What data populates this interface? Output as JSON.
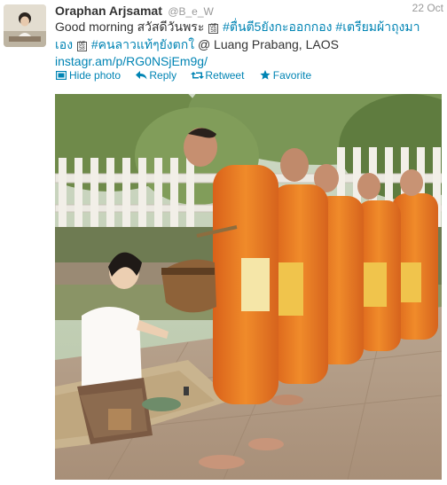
{
  "tweet": {
    "fullname": "Oraphan Arjsamat",
    "username": "@B_e_W",
    "timestamp": "22 Oct",
    "text": {
      "part1": "Good morning สวัสดีวันพระ ",
      "hashtag1": "#ตื่นตี5ยังกะออกกอง",
      "space1": " ",
      "hashtag2": "#เตรียมผ้าถุงมาเอง",
      "space2": " ",
      "hashtag3": "#คนลาวแท้ๆยังตกใ",
      "part2": " @ Luang Prabang, LAOS ",
      "link": "instagr.am/p/RG0NSjEm9g/"
    },
    "actions": {
      "hide_photo": "Hide photo",
      "reply": "Reply",
      "retweet": "Retweet",
      "favorite": "Favorite"
    }
  },
  "colors": {
    "link": "#0084b4",
    "muted": "#999999",
    "text": "#333333",
    "robe": "#e8791e"
  },
  "icons": {
    "hide_photo": "photo-icon",
    "reply": "reply-icon",
    "retweet": "retweet-icon",
    "favorite": "star-icon"
  }
}
